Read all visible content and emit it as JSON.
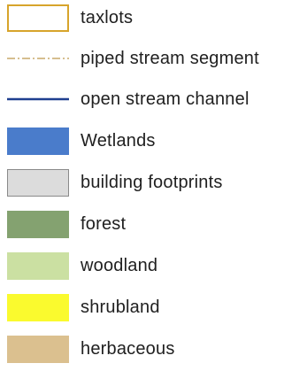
{
  "legend": {
    "items": [
      {
        "label": "taxlots",
        "symbol": "outline-box",
        "color": "#d7a42b",
        "fill": "#ffffff"
      },
      {
        "label": "piped stream segment",
        "symbol": "dash-dot-line",
        "color": "#c9a96a"
      },
      {
        "label": "open stream channel",
        "symbol": "solid-line",
        "color": "#1f3f8f"
      },
      {
        "label": "Wetlands",
        "symbol": "filled-box",
        "color": "#4a7ccb"
      },
      {
        "label": "building footprints",
        "symbol": "outlined-filled-box",
        "color": "#dcdcdc",
        "border": "#8a8a8a"
      },
      {
        "label": "forest",
        "symbol": "filled-box",
        "color": "#84a270"
      },
      {
        "label": "woodland",
        "symbol": "filled-box",
        "color": "#cbe0a2"
      },
      {
        "label": "shrubland",
        "symbol": "filled-box",
        "color": "#fafa2e"
      },
      {
        "label": "herbaceous",
        "symbol": "filled-box",
        "color": "#dbc08f"
      }
    ]
  }
}
